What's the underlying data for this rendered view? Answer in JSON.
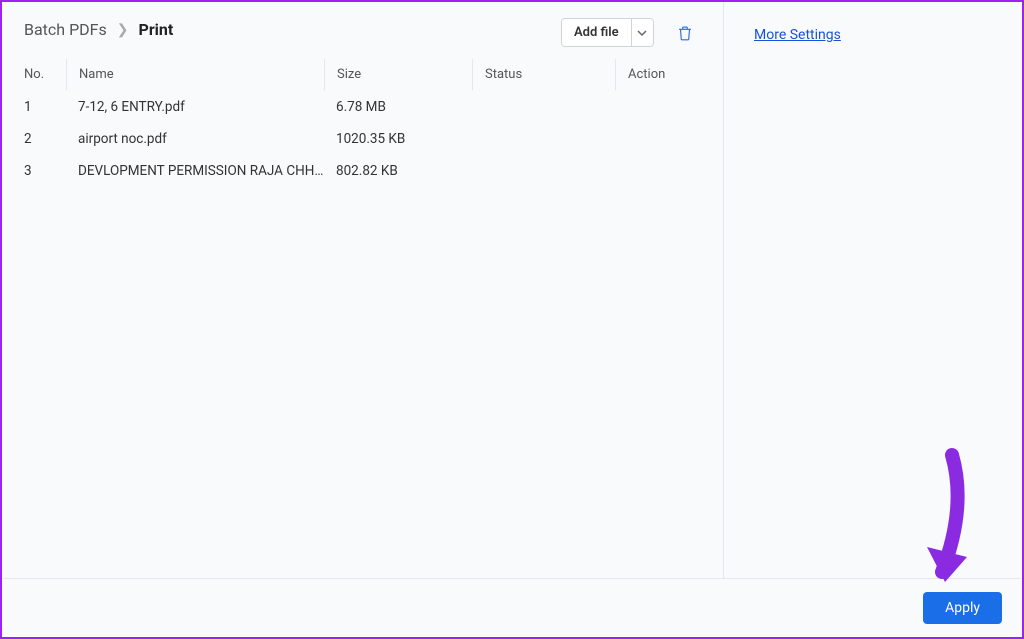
{
  "breadcrumb": {
    "parent": "Batch PDFs",
    "current": "Print"
  },
  "toolbar": {
    "add_file_label": "Add file"
  },
  "table": {
    "headers": {
      "no": "No.",
      "name": "Name",
      "size": "Size",
      "status": "Status",
      "action": "Action"
    },
    "rows": [
      {
        "no": "1",
        "name": "7-12, 6 ENTRY.pdf",
        "size": "6.78 MB",
        "status": "",
        "action": ""
      },
      {
        "no": "2",
        "name": "airport noc.pdf",
        "size": "1020.35 KB",
        "status": "",
        "action": ""
      },
      {
        "no": "3",
        "name": "DEVLOPMENT PERMISSION RAJA CHHIT...",
        "size": "802.82 KB",
        "status": "",
        "action": ""
      }
    ]
  },
  "sidebar": {
    "more_settings": "More Settings"
  },
  "footer": {
    "apply_label": "Apply"
  }
}
